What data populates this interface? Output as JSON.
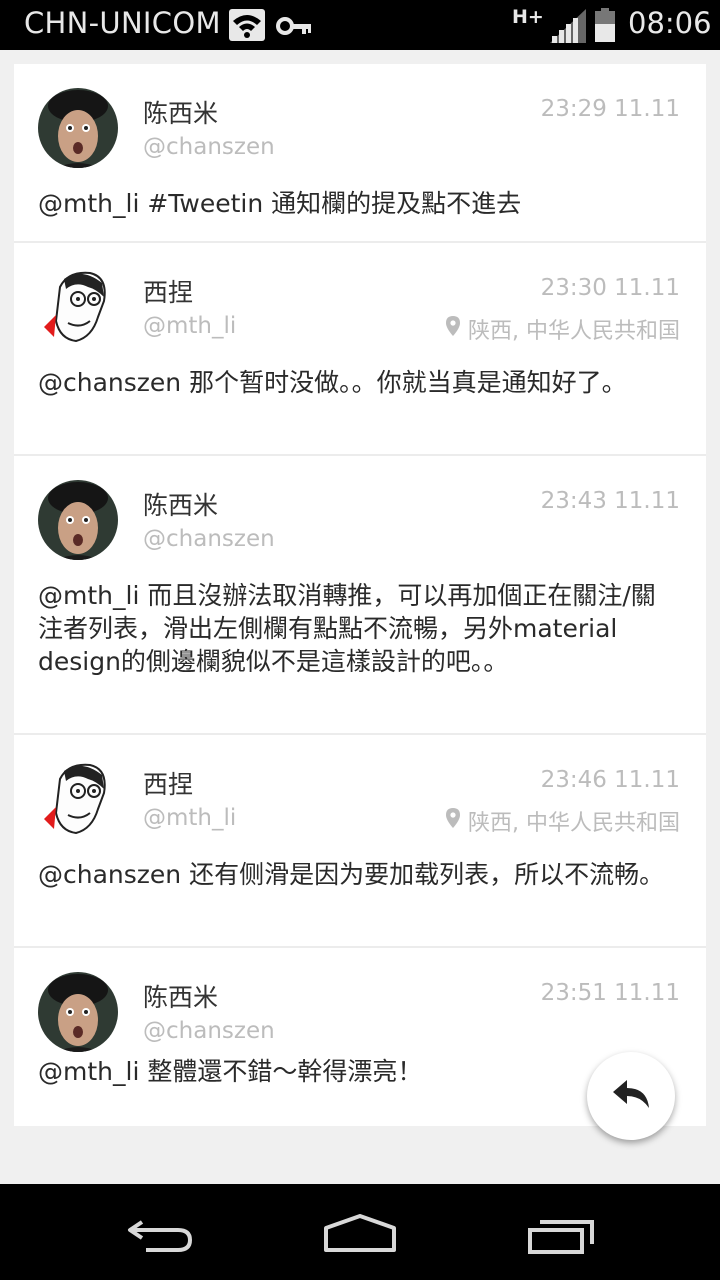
{
  "status_bar": {
    "carrier": "CHN-UNICOM",
    "network_type": "H+",
    "time": "08:06",
    "icons": [
      "wifi-icon",
      "key-icon",
      "signal-icon",
      "battery-icon"
    ]
  },
  "colors": {
    "background": "#f0f0f0",
    "card": "#ffffff",
    "meta_text": "#bcbcbc",
    "body_text": "#2a2a2a"
  },
  "tweets": [
    {
      "name": "陈西米",
      "handle": "@chanszen",
      "time": "23:29 11.11",
      "location": "",
      "text": "@mth_li #Tweetin 通知欄的提及點不進去",
      "avatar": "photo-avatar"
    },
    {
      "name": "西捏",
      "handle": "@mth_li",
      "time": "23:30 11.11",
      "location": "陕西, 中华人民共和国",
      "text": "@chanszen 那个暂时没做。。你就当真是通知好了。",
      "avatar": "cartoon-avatar"
    },
    {
      "name": "陈西米",
      "handle": "@chanszen",
      "time": "23:43 11.11",
      "location": "",
      "text": "@mth_li 而且沒辦法取消轉推，可以再加個正在關注/關注者列表，滑出左側欄有點點不流暢，另外material design的側邊欄貌似不是這樣設計的吧。。",
      "avatar": "photo-avatar"
    },
    {
      "name": "西捏",
      "handle": "@mth_li",
      "time": "23:46 11.11",
      "location": "陕西, 中华人民共和国",
      "text": "@chanszen 还有侧滑是因为要加载列表，所以不流畅。",
      "avatar": "cartoon-avatar"
    },
    {
      "name": "陈西米",
      "handle": "@chanszen",
      "time": "23:51 11.11",
      "location": "",
      "text": "@mth_li 整體還不錯～幹得漂亮！",
      "avatar": "photo-avatar"
    }
  ],
  "fab": {
    "icon": "reply-icon"
  },
  "nav_bar": {
    "icons": [
      "back-icon",
      "home-icon",
      "recents-icon"
    ]
  }
}
